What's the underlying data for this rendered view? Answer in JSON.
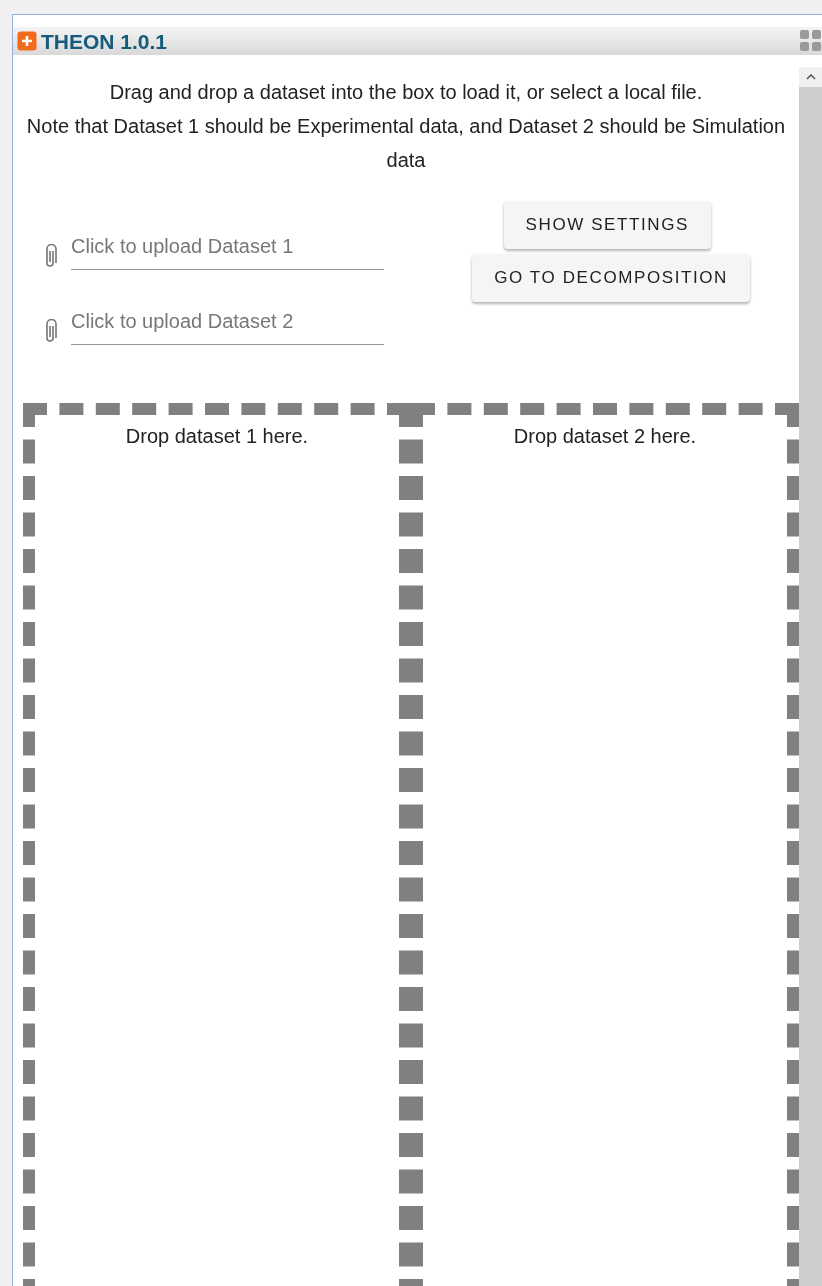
{
  "window": {
    "title": "THEON 1.0.1"
  },
  "instructions": [
    "Drag and drop a dataset into the box to load it, or select a local file.",
    "Note that Dataset 1 should be Experimental data, and Dataset 2 should be Simulation data"
  ],
  "uploads": [
    {
      "placeholder": "Click to upload Dataset 1",
      "button": "SHOW SETTINGS"
    },
    {
      "placeholder": "Click to upload Dataset 2",
      "button": "GO TO DECOMPOSITION"
    }
  ],
  "drop_zones": [
    "Drop dataset 1 here.",
    "Drop dataset 2 here."
  ]
}
